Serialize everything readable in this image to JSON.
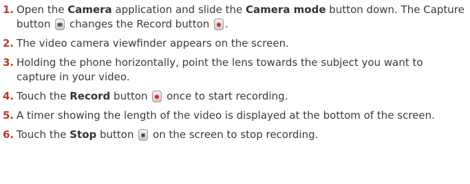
{
  "steps": [
    {
      "num": "1.",
      "parts": [
        "Open the ",
        "Camera",
        " application and slide the ",
        "Camera mode",
        " button down. The Capture button ",
        " changes the Record button ",
        "."
      ]
    },
    {
      "num": "2.",
      "text": "The video camera viewfinder appears on the screen."
    },
    {
      "num": "3.",
      "text": "Holding the phone horizontally, point the lens towards the subject you want to capture in your video."
    },
    {
      "num": "4.",
      "parts": [
        "Touch the ",
        "Record",
        " button ",
        " once to start recording."
      ]
    },
    {
      "num": "5.",
      "text": "A timer showing the length of the video is displayed at the bottom of the screen."
    },
    {
      "num": "6.",
      "parts": [
        "Touch the ",
        "Stop",
        " button ",
        " on the screen to stop recording."
      ]
    }
  ],
  "icons": {
    "capture": "camera-capture-icon",
    "record": "record-icon",
    "stop": "stop-icon"
  },
  "colors": {
    "number": "#b83a2a",
    "text": "#3a3a3a",
    "record_dot": "#e2202a"
  }
}
